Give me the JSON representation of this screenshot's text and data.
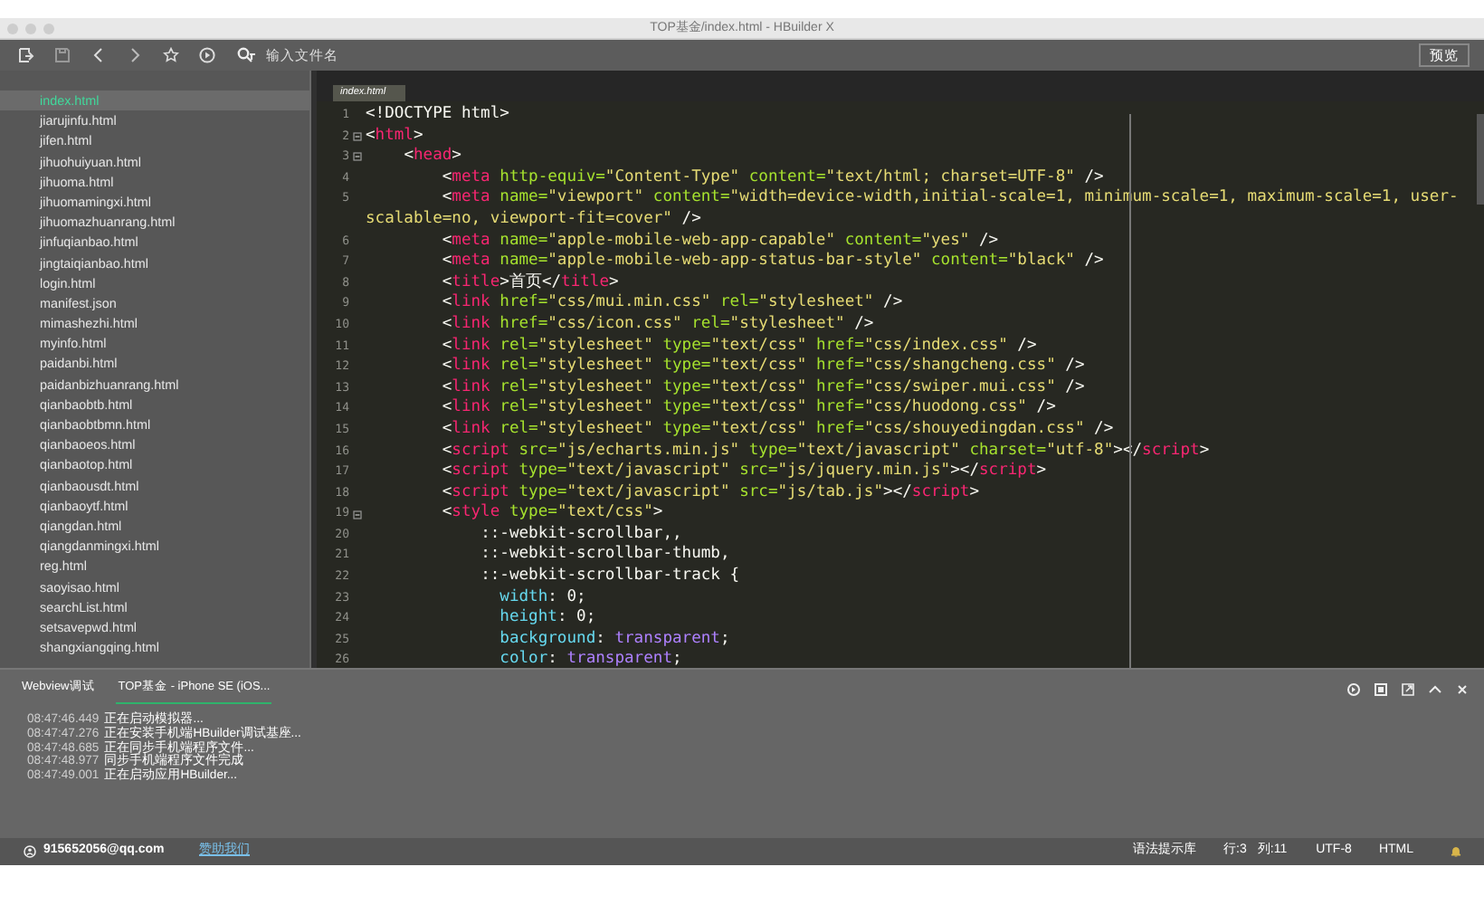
{
  "window": {
    "title": "TOP基金/index.html - HBuilder X"
  },
  "toolbar": {
    "search": {
      "placeholder": "输入文件名"
    },
    "preview_button": "预览"
  },
  "sidebar": {
    "items": [
      {
        "label": "index.html",
        "selected": true
      },
      {
        "label": "jiarujinfu.html",
        "selected": false
      },
      {
        "label": "jifen.html",
        "selected": false
      },
      {
        "label": "jihuohuiyuan.html",
        "selected": false
      },
      {
        "label": "jihuoma.html",
        "selected": false
      },
      {
        "label": "jihuomamingxi.html",
        "selected": false
      },
      {
        "label": "jihuomazhuanrang.html",
        "selected": false
      },
      {
        "label": "jinfuqianbao.html",
        "selected": false
      },
      {
        "label": "jingtaiqianbao.html",
        "selected": false
      },
      {
        "label": "login.html",
        "selected": false
      },
      {
        "label": "manifest.json",
        "selected": false
      },
      {
        "label": "mimashezhi.html",
        "selected": false
      },
      {
        "label": "myinfo.html",
        "selected": false
      },
      {
        "label": "paidanbi.html",
        "selected": false
      },
      {
        "label": "paidanbizhuanrang.html",
        "selected": false
      },
      {
        "label": "qianbaobtb.html",
        "selected": false
      },
      {
        "label": "qianbaobtbmn.html",
        "selected": false
      },
      {
        "label": "qianbaoeos.html",
        "selected": false
      },
      {
        "label": "qianbaotop.html",
        "selected": false
      },
      {
        "label": "qianbaousdt.html",
        "selected": false
      },
      {
        "label": "qianbaoytf.html",
        "selected": false
      },
      {
        "label": "qiangdan.html",
        "selected": false
      },
      {
        "label": "qiangdanmingxi.html",
        "selected": false
      },
      {
        "label": "reg.html",
        "selected": false
      },
      {
        "label": "saoyisao.html",
        "selected": false
      },
      {
        "label": "searchList.html",
        "selected": false
      },
      {
        "label": "setsavepwd.html",
        "selected": false
      },
      {
        "label": "shangxiangqing.html",
        "selected": false
      }
    ]
  },
  "editor": {
    "tab": "index.html",
    "lines": [
      {
        "number": "1",
        "fold": false,
        "code": "<!DOCTYPE html>"
      },
      {
        "number": "2",
        "fold": true,
        "code": "<html>"
      },
      {
        "number": "3",
        "fold": true,
        "code": "    <head>"
      },
      {
        "number": "4",
        "fold": false,
        "code": "        <meta http-equiv=\"Content-Type\" content=\"text/html; charset=UTF-8\" />"
      },
      {
        "number": "5",
        "fold": false,
        "code": "        <meta name=\"viewport\" content=\"width=device-width,initial-scale=1, minimum-scale=1, maximum-scale=1, user-scalable=no, viewport-fit=cover\" />"
      },
      {
        "number": "6",
        "fold": false,
        "code": "        <meta name=\"apple-mobile-web-app-capable\" content=\"yes\" />"
      },
      {
        "number": "7",
        "fold": false,
        "code": "        <meta name=\"apple-mobile-web-app-status-bar-style\" content=\"black\" />"
      },
      {
        "number": "8",
        "fold": false,
        "code": "        <title>首页</title>"
      },
      {
        "number": "9",
        "fold": false,
        "code": "        <link href=\"css/mui.min.css\" rel=\"stylesheet\" />"
      },
      {
        "number": "10",
        "fold": false,
        "code": "        <link href=\"css/icon.css\" rel=\"stylesheet\" />"
      },
      {
        "number": "11",
        "fold": false,
        "code": "        <link rel=\"stylesheet\" type=\"text/css\" href=\"css/index.css\" />"
      },
      {
        "number": "12",
        "fold": false,
        "code": "        <link rel=\"stylesheet\" type=\"text/css\" href=\"css/shangcheng.css\" />"
      },
      {
        "number": "13",
        "fold": false,
        "code": "        <link rel=\"stylesheet\" type=\"text/css\" href=\"css/swiper.mui.css\" />"
      },
      {
        "number": "14",
        "fold": false,
        "code": "        <link rel=\"stylesheet\" type=\"text/css\" href=\"css/huodong.css\" />"
      },
      {
        "number": "15",
        "fold": false,
        "code": "        <link rel=\"stylesheet\" type=\"text/css\" href=\"css/shouyedingdan.css\" />"
      },
      {
        "number": "16",
        "fold": false,
        "code": "        <script src=\"js/echarts.min.js\" type=\"text/javascript\" charset=\"utf-8\"></script>"
      },
      {
        "number": "17",
        "fold": false,
        "code": "        <script type=\"text/javascript\" src=\"js/jquery.min.js\"></script>"
      },
      {
        "number": "18",
        "fold": false,
        "code": "        <script type=\"text/javascript\" src=\"js/tab.js\"></script>"
      },
      {
        "number": "19",
        "fold": true,
        "code": "        <style type=\"text/css\">"
      },
      {
        "number": "20",
        "fold": false,
        "code": "            ::-webkit-scrollbar,,"
      },
      {
        "number": "21",
        "fold": false,
        "code": "            ::-webkit-scrollbar-thumb,"
      },
      {
        "number": "22",
        "fold": false,
        "code": "            ::-webkit-scrollbar-track {"
      },
      {
        "number": "23",
        "fold": false,
        "code": "              width: 0;"
      },
      {
        "number": "24",
        "fold": false,
        "code": "              height: 0;"
      },
      {
        "number": "25",
        "fold": false,
        "code": "              background: transparent;"
      },
      {
        "number": "26",
        "fold": false,
        "code": "              color: transparent;"
      }
    ]
  },
  "bottom_panel": {
    "tabs": [
      {
        "label": "Webview调试",
        "selected": false
      },
      {
        "label": "TOP基金 - iPhone SE (iOS...",
        "selected": true
      }
    ],
    "log": [
      {
        "time": "08:47:46.449",
        "message": "正在启动模拟器..."
      },
      {
        "time": "08:47:47.276",
        "message": "正在安装手机端HBuilder调试基座..."
      },
      {
        "time": "08:47:48.685",
        "message": "正在同步手机端程序文件..."
      },
      {
        "time": "08:47:48.977",
        "message": "同步手机端程序文件完成"
      },
      {
        "time": "08:47:49.001",
        "message": "正在启动应用HBuilder..."
      }
    ]
  },
  "status_bar": {
    "account": "915652056@qq.com",
    "link": "赞助我们",
    "items": [
      "语法提示库",
      "行:3",
      "列:11",
      "UTF-8",
      "HTML"
    ]
  }
}
